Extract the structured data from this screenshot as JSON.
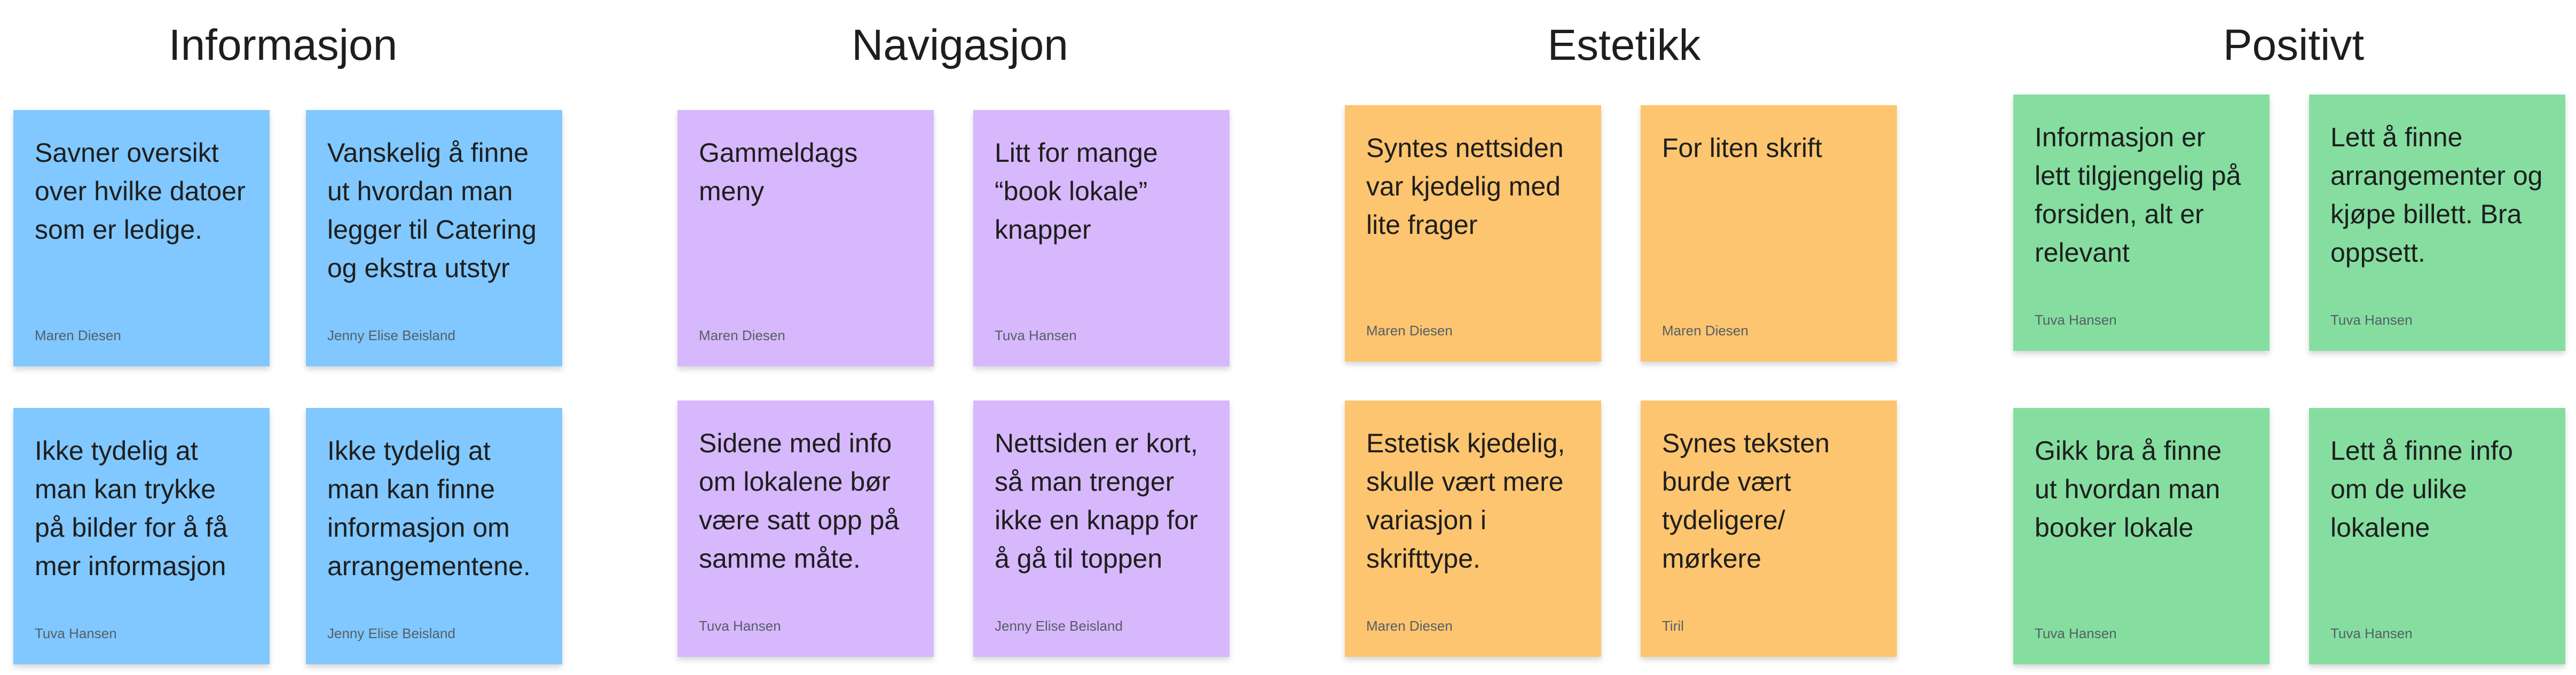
{
  "colors": {
    "informasjon": "#80c8ff",
    "navigasjon": "#d7b8fc",
    "estetikk": "#fdc56f",
    "positivt": "#85dea0"
  },
  "groups": [
    {
      "title": "Informasjon",
      "notes": [
        {
          "text": "Savner oversikt over hvilke datoer som er ledige.",
          "author": "Maren Diesen"
        },
        {
          "text": "Vanskelig å finne ut hvordan man legger til Catering og ekstra utstyr",
          "author": "Jenny Elise Beisland"
        },
        {
          "text": "Ikke tydelig at man kan trykke på bilder for å få mer informasjon",
          "author": "Tuva Hansen"
        },
        {
          "text": "Ikke tydelig at man kan finne informasjon om arrangementene.",
          "author": "Jenny Elise Beisland"
        }
      ]
    },
    {
      "title": "Navigasjon",
      "notes": [
        {
          "text": "Gammeldags meny",
          "author": "Maren Diesen"
        },
        {
          "text": "Litt for mange “book lokale” knapper",
          "author": "Tuva Hansen"
        },
        {
          "text": "Sidene med info om lokalene bør være satt opp på samme måte.",
          "author": "Tuva Hansen"
        },
        {
          "text": "Nettsiden er kort, så man trenger ikke en knapp for å gå til toppen",
          "author": "Jenny Elise Beisland"
        }
      ]
    },
    {
      "title": "Estetikk",
      "notes": [
        {
          "text": "Syntes nettsiden var kjedelig med lite frager",
          "author": "Maren Diesen"
        },
        {
          "text": "For liten skrift",
          "author": "Maren Diesen"
        },
        {
          "text": "Estetisk kjedelig, skulle vært mere variasjon i skrifttype.",
          "author": "Maren Diesen"
        },
        {
          "text": "Synes teksten burde vært tydeligere/ mørkere",
          "author": "Tiril"
        }
      ]
    },
    {
      "title": "Positivt",
      "notes": [
        {
          "text": "Informasjon er lett tilgjengelig på forsiden, alt er relevant",
          "author": "Tuva Hansen"
        },
        {
          "text": "Lett å finne arrangementer og kjøpe billett. Bra oppsett.",
          "author": "Tuva Hansen"
        },
        {
          "text": "Gikk bra å finne ut hvordan man booker lokale",
          "author": "Tuva Hansen"
        },
        {
          "text": "Lett å finne info om de ulike lokalene",
          "author": "Tuva Hansen"
        }
      ]
    }
  ]
}
